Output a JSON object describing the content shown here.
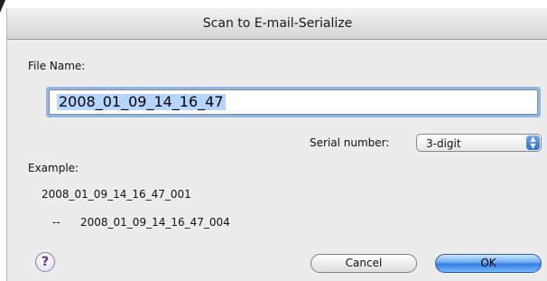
{
  "window": {
    "title": "Scan to E-mail-Serialize"
  },
  "file_name": {
    "label": "File Name:",
    "value": "2008_01_09_14_16_47"
  },
  "serial_number": {
    "label": "Serial number:",
    "selected": "3-digit",
    "arrow_icon": "updown-arrows-icon"
  },
  "example": {
    "label": "Example:",
    "first": "2008_01_09_14_16_47_001",
    "dash": "--",
    "last": "2008_01_09_14_16_47_004"
  },
  "buttons": {
    "help": "?",
    "cancel": "Cancel",
    "ok": "OK"
  },
  "colors": {
    "accent": "#2f7ae0",
    "selection": "#b5d5fe",
    "focus_ring": "#8fb8e8"
  }
}
